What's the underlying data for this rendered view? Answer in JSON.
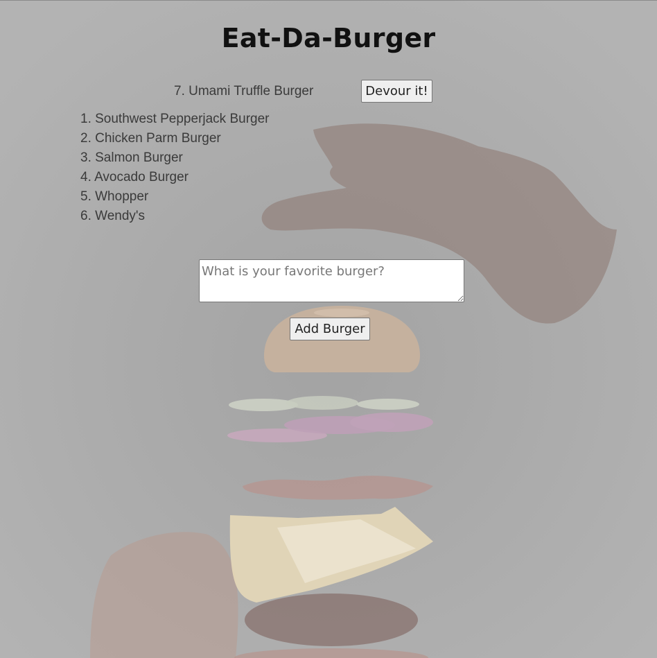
{
  "page": {
    "title": "Eat-Da-Burger"
  },
  "devoured": {
    "label": "7. Umami Truffle Burger",
    "button_label": "Devour it!"
  },
  "burgers": [
    "1. Southwest Pepperjack Burger",
    "2. Chicken Parm Burger",
    "3. Salmon Burger",
    "4. Avocado Burger",
    "5. Whopper",
    "6. Wendy's"
  ],
  "form": {
    "placeholder": "What is your favorite burger?",
    "value": "",
    "button_label": "Add Burger"
  }
}
